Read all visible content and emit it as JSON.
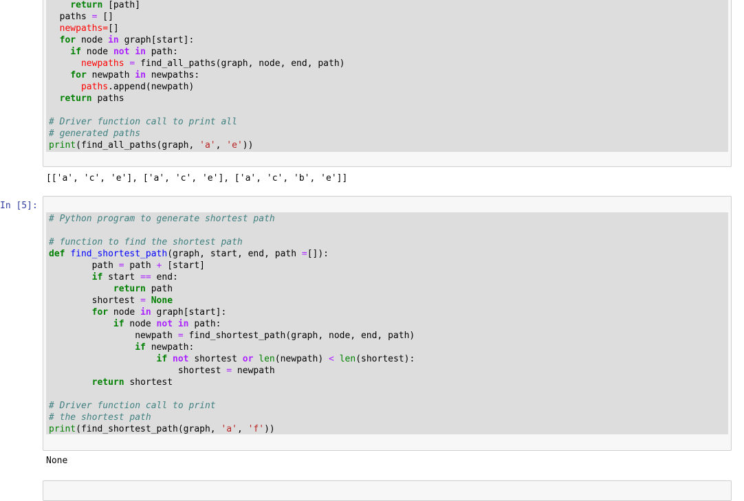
{
  "cell1": {
    "lines": [
      [
        {
          "t": "    "
        },
        {
          "t": "return",
          "c": "kw"
        },
        {
          "t": " [path]"
        }
      ],
      [
        {
          "t": "  paths "
        },
        {
          "t": "=",
          "c": "op"
        },
        {
          "t": " []"
        }
      ],
      [
        {
          "t": "  "
        },
        {
          "t": "newpaths=",
          "c": "rd"
        },
        {
          "t": "[]"
        }
      ],
      [
        {
          "t": "  "
        },
        {
          "t": "for",
          "c": "kw"
        },
        {
          "t": " node "
        },
        {
          "t": "in",
          "c": "ow"
        },
        {
          "t": " graph[start]:"
        }
      ],
      [
        {
          "t": "    "
        },
        {
          "t": "if",
          "c": "kw"
        },
        {
          "t": " node "
        },
        {
          "t": "not",
          "c": "ow"
        },
        {
          "t": " "
        },
        {
          "t": "in",
          "c": "ow"
        },
        {
          "t": " path:"
        }
      ],
      [
        {
          "t": "      "
        },
        {
          "t": "newpaths",
          "c": "rd"
        },
        {
          "t": " "
        },
        {
          "t": "=",
          "c": "op"
        },
        {
          "t": " find_all_paths(graph, node, end, path)"
        }
      ],
      [
        {
          "t": "    "
        },
        {
          "t": "for",
          "c": "kw"
        },
        {
          "t": " newpath "
        },
        {
          "t": "in",
          "c": "ow"
        },
        {
          "t": " newpaths:"
        }
      ],
      [
        {
          "t": "      "
        },
        {
          "t": "paths",
          "c": "rd"
        },
        {
          "t": ".append(newpath)"
        }
      ],
      [
        {
          "t": "  "
        },
        {
          "t": "return",
          "c": "kw"
        },
        {
          "t": " paths"
        }
      ],
      [
        {
          "t": ""
        }
      ],
      [
        {
          "t": "# Driver function call to print all",
          "c": "cm"
        }
      ],
      [
        {
          "t": "# generated paths",
          "c": "cm"
        }
      ],
      [
        {
          "t": "print",
          "c": "bi"
        },
        {
          "t": "(find_all_paths(graph, "
        },
        {
          "t": "'a'",
          "c": "st"
        },
        {
          "t": ", "
        },
        {
          "t": "'e'",
          "c": "st"
        },
        {
          "t": "))"
        }
      ]
    ],
    "output": "[['a', 'c', 'e'], ['a', 'c', 'e'], ['a', 'c', 'b', 'e']]"
  },
  "cell2": {
    "prompt": "In [5]:",
    "lines": [
      [
        {
          "t": "# Python program to generate shortest path",
          "c": "cm"
        }
      ],
      [
        {
          "t": ""
        }
      ],
      [
        {
          "t": "# function to find the shortest path",
          "c": "cm"
        }
      ],
      [
        {
          "t": "def",
          "c": "kw"
        },
        {
          "t": " "
        },
        {
          "t": "find_shortest_path",
          "c": "fn"
        },
        {
          "t": "(graph, start, end, path "
        },
        {
          "t": "=",
          "c": "op"
        },
        {
          "t": "[]):"
        }
      ],
      [
        {
          "t": "        path "
        },
        {
          "t": "=",
          "c": "op"
        },
        {
          "t": " path "
        },
        {
          "t": "+",
          "c": "op"
        },
        {
          "t": " [start]"
        }
      ],
      [
        {
          "t": "        "
        },
        {
          "t": "if",
          "c": "kw"
        },
        {
          "t": " start "
        },
        {
          "t": "==",
          "c": "op"
        },
        {
          "t": " end:"
        }
      ],
      [
        {
          "t": "            "
        },
        {
          "t": "return",
          "c": "kw"
        },
        {
          "t": " path"
        }
      ],
      [
        {
          "t": "        shortest "
        },
        {
          "t": "=",
          "c": "op"
        },
        {
          "t": " "
        },
        {
          "t": "None",
          "c": "kw"
        }
      ],
      [
        {
          "t": "        "
        },
        {
          "t": "for",
          "c": "kw"
        },
        {
          "t": " node "
        },
        {
          "t": "in",
          "c": "ow"
        },
        {
          "t": " graph[start]:"
        }
      ],
      [
        {
          "t": "            "
        },
        {
          "t": "if",
          "c": "kw"
        },
        {
          "t": " node "
        },
        {
          "t": "not",
          "c": "ow"
        },
        {
          "t": " "
        },
        {
          "t": "in",
          "c": "ow"
        },
        {
          "t": " path:"
        }
      ],
      [
        {
          "t": "                newpath "
        },
        {
          "t": "=",
          "c": "op"
        },
        {
          "t": " find_shortest_path(graph, node, end, path)"
        }
      ],
      [
        {
          "t": "                "
        },
        {
          "t": "if",
          "c": "kw"
        },
        {
          "t": " newpath:"
        }
      ],
      [
        {
          "t": "                    "
        },
        {
          "t": "if",
          "c": "kw"
        },
        {
          "t": " "
        },
        {
          "t": "not",
          "c": "ow"
        },
        {
          "t": " shortest "
        },
        {
          "t": "or",
          "c": "ow"
        },
        {
          "t": " "
        },
        {
          "t": "len",
          "c": "bi"
        },
        {
          "t": "(newpath) "
        },
        {
          "t": "<",
          "c": "op"
        },
        {
          "t": " "
        },
        {
          "t": "len",
          "c": "bi"
        },
        {
          "t": "(shortest):"
        }
      ],
      [
        {
          "t": "                        shortest "
        },
        {
          "t": "=",
          "c": "op"
        },
        {
          "t": " newpath"
        }
      ],
      [
        {
          "t": "        "
        },
        {
          "t": "return",
          "c": "kw"
        },
        {
          "t": " shortest"
        }
      ],
      [
        {
          "t": ""
        }
      ],
      [
        {
          "t": "# Driver function call to print",
          "c": "cm"
        }
      ],
      [
        {
          "t": "# the shortest path",
          "c": "cm"
        }
      ],
      [
        {
          "t": "print",
          "c": "bi"
        },
        {
          "t": "(find_shortest_path(graph, "
        },
        {
          "t": "'a'",
          "c": "st"
        },
        {
          "t": ", "
        },
        {
          "t": "'f'",
          "c": "st"
        },
        {
          "t": "))"
        }
      ]
    ],
    "output": "None"
  },
  "colors": {
    "keyword": "#008000",
    "operator_word": "#aa22ff",
    "string": "#ba2121",
    "comment": "#408080",
    "function_name": "#0000ff",
    "error_highlight": "#ff0000",
    "prompt": "#303f9f",
    "code_bg": "#dddddd",
    "cell_bg": "#f7f7f7"
  }
}
